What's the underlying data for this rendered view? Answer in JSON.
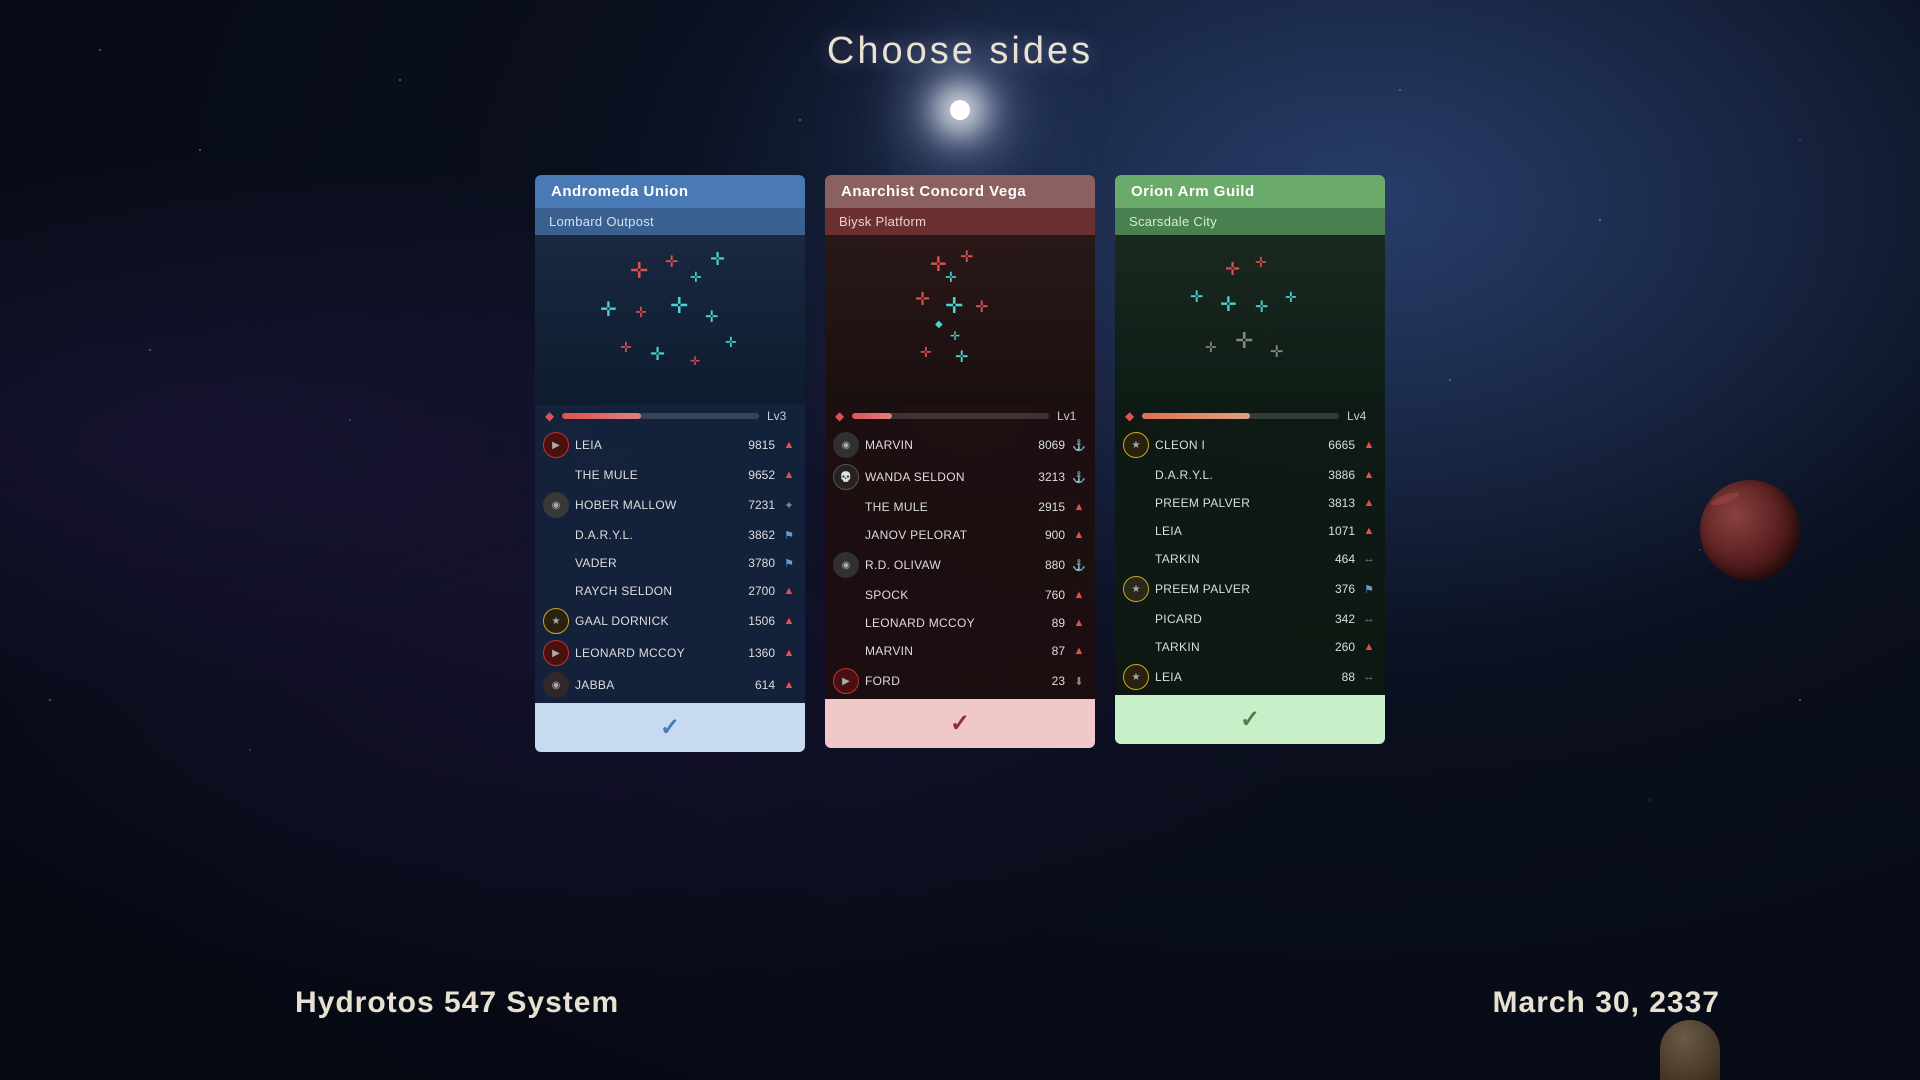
{
  "page": {
    "title": "Choose sides",
    "bottom_left": "Hydrotos 547 System",
    "bottom_right": "March 30, 2337"
  },
  "factions": [
    {
      "id": "andromeda",
      "name": "Andromeda Union",
      "location": "Lombard Outpost",
      "level": "Lv3",
      "level_pct": 40,
      "color_class": "card-andromeda",
      "header_color": "#4a7ab5",
      "sub_color": "#3a6090",
      "players": [
        {
          "name": "LEIA",
          "score": "9815",
          "rank": "▲",
          "has_avatar": true,
          "avatar_type": "red-border"
        },
        {
          "name": "THE MULE",
          "score": "9652",
          "rank": "▲",
          "has_avatar": false
        },
        {
          "name": "HOBER MALLOW",
          "score": "7231",
          "rank": "✦",
          "has_avatar": true,
          "avatar_type": "gray"
        },
        {
          "name": "D.A.R.Y.L.",
          "score": "3862",
          "rank": "⚑",
          "has_avatar": false
        },
        {
          "name": "VADER",
          "score": "3780",
          "rank": "⚑",
          "has_avatar": false
        },
        {
          "name": "RAYCH SELDON",
          "score": "2700",
          "rank": "▲",
          "has_avatar": false
        },
        {
          "name": "GAAL DORNICK",
          "score": "1506",
          "rank": "▲",
          "has_avatar": true,
          "avatar_type": "gold-border"
        },
        {
          "name": "LEONARD MCCOY",
          "score": "1360",
          "rank": "▲",
          "has_avatar": true,
          "avatar_type": "red-border"
        },
        {
          "name": "JABBA",
          "score": "614",
          "rank": "▲",
          "has_avatar": true,
          "avatar_type": "gray"
        }
      ],
      "checkmark": "✓"
    },
    {
      "id": "anarchist",
      "name": "Anarchist Concord Vega",
      "location": "Biysk Platform",
      "level": "Lv1",
      "level_pct": 20,
      "color_class": "card-anarchist",
      "header_color": "#8b6060",
      "sub_color": "#6a3030",
      "players": [
        {
          "name": "MARVIN",
          "score": "8069",
          "rank": "⚓",
          "has_avatar": true,
          "avatar_type": "gray"
        },
        {
          "name": "WANDA SELDON",
          "score": "3213",
          "rank": "⚓",
          "has_avatar": true,
          "avatar_type": "gray"
        },
        {
          "name": "THE MULE",
          "score": "2915",
          "rank": "▲",
          "has_avatar": false
        },
        {
          "name": "JANOV PELORAT",
          "score": "900",
          "rank": "▲",
          "has_avatar": false
        },
        {
          "name": "R.D. OLIVAW",
          "score": "880",
          "rank": "⚓",
          "has_avatar": true,
          "avatar_type": "gray"
        },
        {
          "name": "SPOCK",
          "score": "760",
          "rank": "▲",
          "has_avatar": false
        },
        {
          "name": "LEONARD MCCOY",
          "score": "89",
          "rank": "▲",
          "has_avatar": false
        },
        {
          "name": "MARVIN",
          "score": "87",
          "rank": "▲",
          "has_avatar": false
        },
        {
          "name": "FORD",
          "score": "23",
          "rank": "⬇",
          "has_avatar": true,
          "avatar_type": "red-border"
        }
      ],
      "checkmark": "✓"
    },
    {
      "id": "orion",
      "name": "Orion Arm Guild",
      "location": "Scarsdale City",
      "level": "Lv4",
      "level_pct": 55,
      "color_class": "card-orion",
      "header_color": "#6aaa6a",
      "sub_color": "#4a8050",
      "players": [
        {
          "name": "CLEON I",
          "score": "6665",
          "rank": "▲",
          "has_avatar": true,
          "avatar_type": "gold-border"
        },
        {
          "name": "D.A.R.Y.L.",
          "score": "3886",
          "rank": "▲",
          "has_avatar": false
        },
        {
          "name": "PREEM PALVER",
          "score": "3813",
          "rank": "▲",
          "has_avatar": false
        },
        {
          "name": "LEIA",
          "score": "1071",
          "rank": "▲",
          "has_avatar": false
        },
        {
          "name": "TARKIN",
          "score": "464",
          "rank": "↔",
          "has_avatar": false
        },
        {
          "name": "PREEM PALVER",
          "score": "376",
          "rank": "⚑",
          "has_avatar": true,
          "avatar_type": "gray"
        },
        {
          "name": "PICARD",
          "score": "342",
          "rank": "↔",
          "has_avatar": false
        },
        {
          "name": "TARKIN",
          "score": "260",
          "rank": "▲",
          "has_avatar": false
        },
        {
          "name": "LEIA",
          "score": "88",
          "rank": "↔",
          "has_avatar": true,
          "avatar_type": "gold-border"
        }
      ],
      "checkmark": "✓"
    }
  ]
}
